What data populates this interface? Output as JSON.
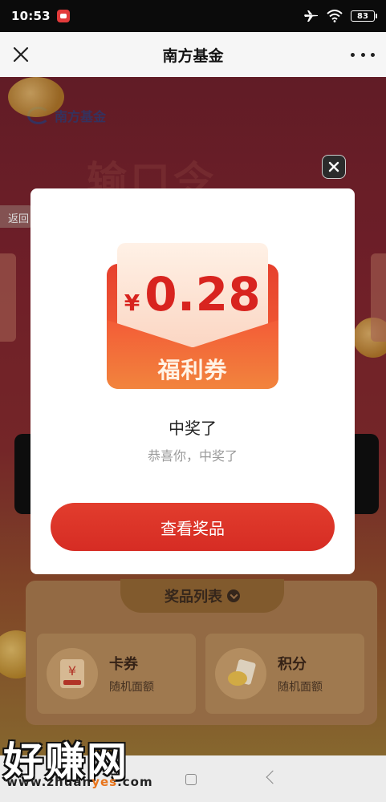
{
  "status_bar": {
    "time": "10:53",
    "battery": "83",
    "icons": [
      "app-badge-icon",
      "airplane-icon",
      "wifi-icon",
      "battery-icon"
    ]
  },
  "nav": {
    "title": "南方基金",
    "close_icon": "close-icon",
    "more_icon": "more-icon"
  },
  "background": {
    "brand": "南方基金",
    "banner_title": "输口令",
    "back_tab": "返回",
    "prize_list_title": "奖品列表",
    "prizes": [
      {
        "name": "卡券",
        "desc": "随机面额",
        "icon": "voucher-icon"
      },
      {
        "name": "积分",
        "desc": "随机面额",
        "icon": "points-icon"
      }
    ]
  },
  "modal": {
    "currency": "¥",
    "amount": "0.28",
    "coupon_label": "福利券",
    "title": "中奖了",
    "subtitle": "恭喜你，中奖了",
    "button": "查看奖品",
    "close_icon": "close-icon"
  },
  "watermark": {
    "text": "好赚网",
    "url_prefix": "www.zhuan",
    "url_accent": "yes",
    "url_suffix": ".com"
  },
  "colors": {
    "primary_red": "#d62c24",
    "amount_red": "#d8241f",
    "page_bg": "#79222c",
    "accent_orange": "#e8741b"
  }
}
